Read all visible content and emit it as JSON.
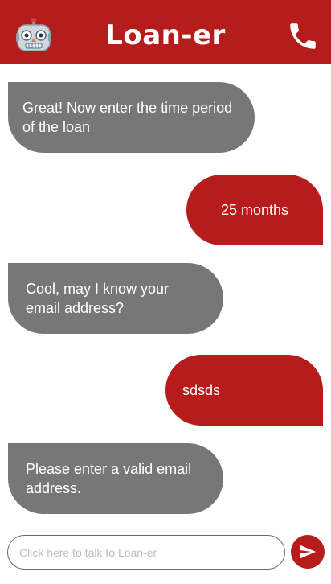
{
  "header": {
    "title": "Loan-er",
    "avatar_icon": "robot-icon",
    "call_icon": "phone-icon",
    "color": "#b71c1c"
  },
  "messages": [
    {
      "sender": "bot",
      "text": "Great! Now enter the time period of the loan"
    },
    {
      "sender": "user",
      "text": "25 months"
    },
    {
      "sender": "bot",
      "text": "Cool, may I know your email address?"
    },
    {
      "sender": "user",
      "text": "sdsds"
    },
    {
      "sender": "bot",
      "text": "Please enter a valid email address."
    }
  ],
  "input": {
    "value": "",
    "placeholder": "Click here to talk to Loan-er",
    "send_icon": "send-icon"
  },
  "colors": {
    "bot_bubble": "#777777",
    "user_bubble": "#b71c1c",
    "text_on_bubble": "#ffffff"
  }
}
